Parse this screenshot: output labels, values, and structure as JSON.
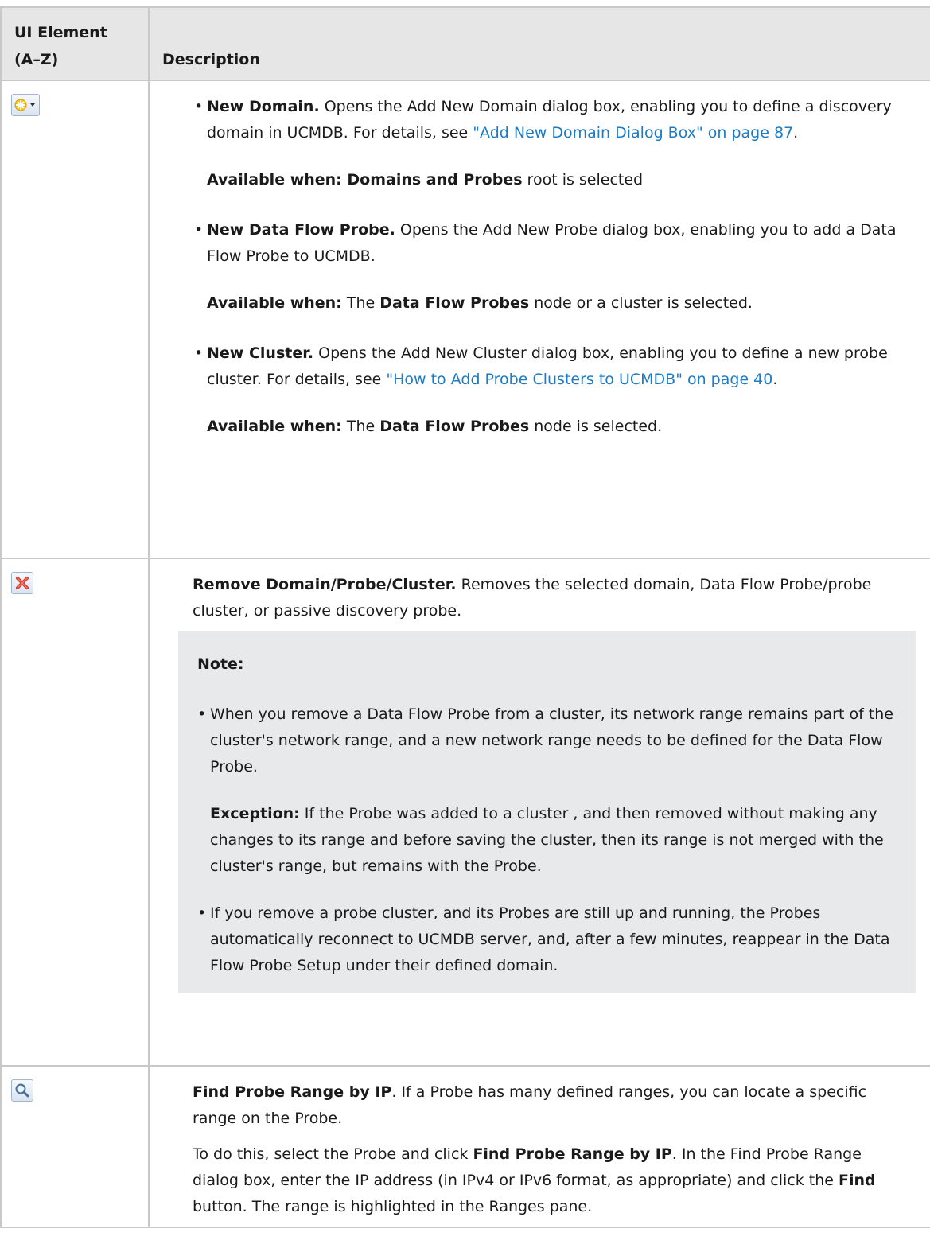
{
  "table": {
    "header_col1": "UI Element (A–Z)",
    "header_col2": "Description"
  },
  "row1": {
    "icon_name": "new-star-dropdown-icon",
    "items": [
      {
        "title": "New Domain.",
        "text": " Opens the Add New Domain dialog box, enabling you to define a discovery domain in UCMDB. For details, see ",
        "link": "\"Add New Domain Dialog Box\" on page 87",
        "after": ".",
        "avail_label": "Available when: Domains and Probes",
        "avail_text": " root is selected"
      },
      {
        "title": "New Data Flow Probe.",
        "text": " Opens the Add New Probe dialog box, enabling you to add a Data Flow Probe to UCMDB.",
        "avail_label": "Available when:",
        "avail_pre": " The ",
        "avail_bold": "Data Flow Probes",
        "avail_text": " node or a cluster is selected."
      },
      {
        "title": "New Cluster.",
        "text": " Opens the Add New Cluster dialog box, enabling you to define a new probe cluster. For details, see ",
        "link": "\"How to Add Probe Clusters to UCMDB\" on page 40",
        "after": ".",
        "avail_label": "Available when:",
        "avail_pre": " The ",
        "avail_bold": "Data Flow Probes",
        "avail_text": " node is selected."
      }
    ]
  },
  "row2": {
    "icon_name": "remove-x-icon",
    "title": "Remove Domain/Probe/Cluster.",
    "text": " Removes the selected domain, Data Flow Probe/probe cluster, or passive discovery probe.",
    "note_title": "Note:",
    "note_items": [
      {
        "text": "When you remove a Data Flow Probe from a cluster, its network range remains part of the cluster's network range, and a new network range needs to be defined for the Data Flow Probe.",
        "exception_label": "Exception:",
        "exception_text": " If the Probe was added to a cluster , and then removed without making any changes to its range and before saving the cluster, then its range is not merged with the cluster's range, but remains with the Probe."
      },
      {
        "text": "If you remove a probe cluster, and its Probes are still up and running, the Probes automatically reconnect to UCMDB server, and, after a few minutes, reappear in the Data Flow Probe Setup under their defined domain."
      }
    ]
  },
  "row3": {
    "icon_name": "magnifier-search-icon",
    "title": "Find Probe Range by IP",
    "text": ". If a Probe has many defined ranges, you can locate a specific range on the Probe.",
    "p2_a": "To do this, select the Probe and click ",
    "p2_bold1": "Find Probe Range by IP",
    "p2_b": ". In the Find Probe Range dialog box, enter the IP address (in IPv4 or IPv6 format, as appropriate) and click the ",
    "p2_bold2": "Find",
    "p2_c": " button. The range is highlighted in the Ranges pane."
  }
}
